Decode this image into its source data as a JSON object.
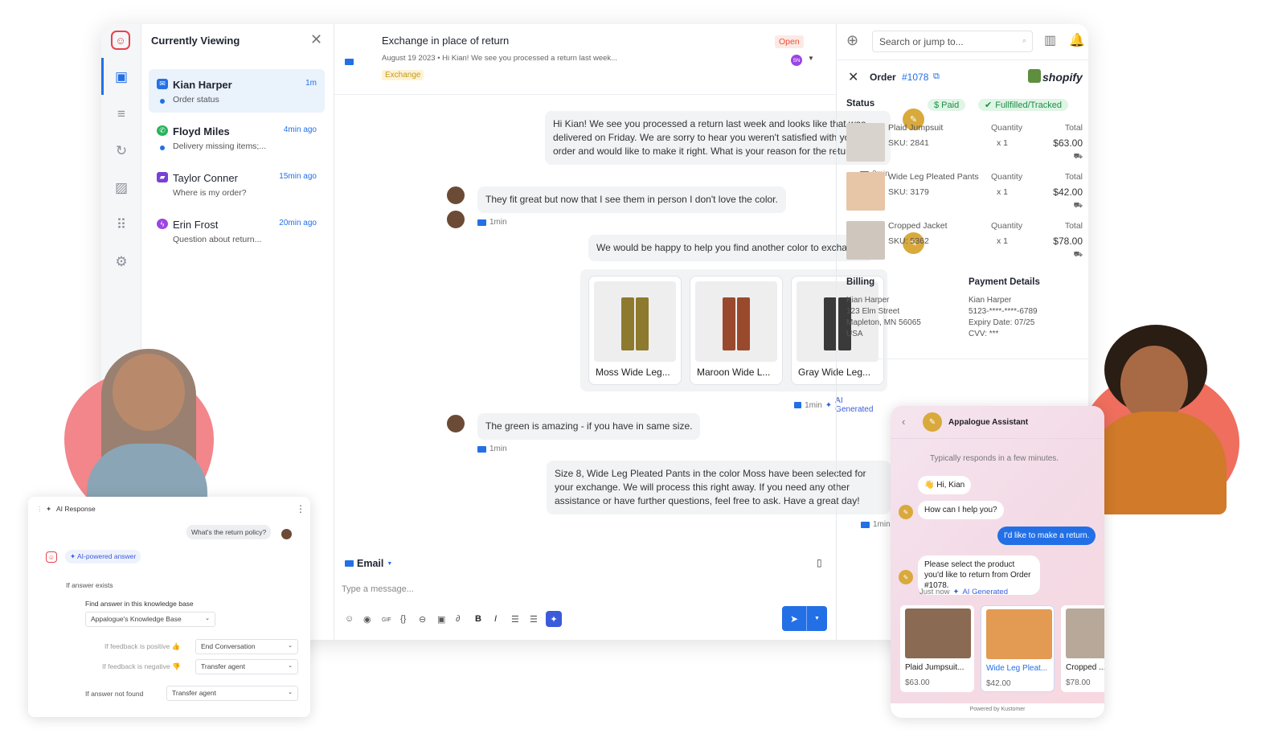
{
  "colors": {
    "brand": "#e8424c",
    "accent": "#2370e6",
    "ai": "#3b5bdb",
    "open_badge": "#e8523c",
    "exchange_badge": "#c79a1a",
    "paid": "#1f8c47"
  },
  "sidebar": {
    "title": "Currently Viewing"
  },
  "conversations": [
    {
      "name": "Kian Harper",
      "time": "1m",
      "subtitle": "Order status",
      "channel": "email"
    },
    {
      "name": "Floyd Miles",
      "time": "4min ago",
      "subtitle": "Delivery missing items;...",
      "channel": "whatsapp"
    },
    {
      "name": "Taylor Conner",
      "time": "15min ago",
      "subtitle": "Where is my order?",
      "channel": "chat"
    },
    {
      "name": "Erin Frost",
      "time": "20min ago",
      "subtitle": "Question about return...",
      "channel": "messenger"
    }
  ],
  "thread": {
    "title": "Exchange in place of return",
    "meta": "August 19 2023  •  Hi Kian! We see you processed a return last week...",
    "tag": "Exchange",
    "status": "Open",
    "assignee_initials": "SN"
  },
  "messages": [
    {
      "text": "Hi Kian! We see you processed a return last week and looks like that was delivered on Friday. We are sorry to hear you weren't satisfied with your order and would like to make it right. What is your reason for the return?",
      "time": "2min"
    },
    {
      "text": "They fit great but now that I see them in person I don't love the color.",
      "time": "1min"
    },
    {
      "text": "We would be happy to help you find another color to exchange."
    },
    {
      "time": "1min",
      "ai": "AI Generated"
    },
    {
      "text": "The green is amazing - if you have in same size.",
      "time": "1min"
    },
    {
      "text": "Size 8, Wide Leg Pleated Pants in the color Moss have been selected for your exchange. We will process this right away. If you need any other assistance or have further questions, feel free to ask. Have a great day!",
      "time": "1min"
    }
  ],
  "product_cards": [
    {
      "label": "Moss Wide Leg...",
      "color": "#8e7a2e"
    },
    {
      "label": "Maroon Wide L...",
      "color": "#9a4a2c"
    },
    {
      "label": "Gray Wide Leg...",
      "color": "#3a3a3a"
    }
  ],
  "composer": {
    "channel": "Email",
    "placeholder": "Type a message..."
  },
  "toolbar": {
    "gif": "GIF",
    "code": "{}",
    "bold": "B",
    "italic": "I"
  },
  "order": {
    "search_placeholder": "Search or jump to...",
    "label": "Order",
    "number": "#1078",
    "brand": "shopify",
    "status_label": "Status",
    "paid": "$ Paid",
    "fulfilled": "Fullfilled/Tracked",
    "items": [
      {
        "name": "Plaid Jumpsuit",
        "sku": "SKU: 2841",
        "qty_label": "Quantity",
        "qty": "x 1",
        "total_label": "Total",
        "total": "$63.00"
      },
      {
        "name": "Wide Leg Pleated Pants",
        "sku": "SKU: 3179",
        "qty_label": "Quantity",
        "qty": "x 1",
        "total_label": "Total",
        "total": "$42.00"
      },
      {
        "name": "Cropped Jacket",
        "sku": "SKU: 5362",
        "qty_label": "Quantity",
        "qty": "x 1",
        "total_label": "Total",
        "total": "$78.00"
      }
    ],
    "billing_title": "Billing",
    "billing": [
      "Kian Harper",
      "123 Elm Street",
      "Mapleton, MN 56065",
      "USA"
    ],
    "payment_title": "Payment Details",
    "payment": [
      "Kian Harper",
      "5123-****-****-6789",
      "Expiry Date: 07/25",
      "CVV: ***"
    ]
  },
  "ai_panel": {
    "title": "AI Response",
    "question": "What's the return policy?",
    "answer_label": "AI-powered answer",
    "if_exists": "If answer exists",
    "find": "Find answer in this knowledge base",
    "kb": "Appalogue's Knowledge Base",
    "pos": "If feedback is positive 👍",
    "pos_action": "End Conversation",
    "neg": "If feedback is negative 👎",
    "neg_action": "Transfer agent",
    "not_found": "If answer not found",
    "not_found_action": "Transfer agent"
  },
  "widget": {
    "title": "Appalogue Assistant",
    "responds": "Typically responds in a few minutes.",
    "hi": "👋 Hi, Kian",
    "help": "How can I help you?",
    "user": "I'd like to make a return.",
    "select": "Please select the product you'd like to return from Order #1078.",
    "just_now": "Just now",
    "ai": "AI Generated",
    "products": [
      {
        "name": "Plaid Jumpsuit...",
        "price": "$63.00"
      },
      {
        "name": "Wide Leg Pleat...",
        "price": "$42.00"
      },
      {
        "name": "Cropped ...",
        "price": "$78.00"
      }
    ],
    "powered": "Powered by Kustomer"
  }
}
